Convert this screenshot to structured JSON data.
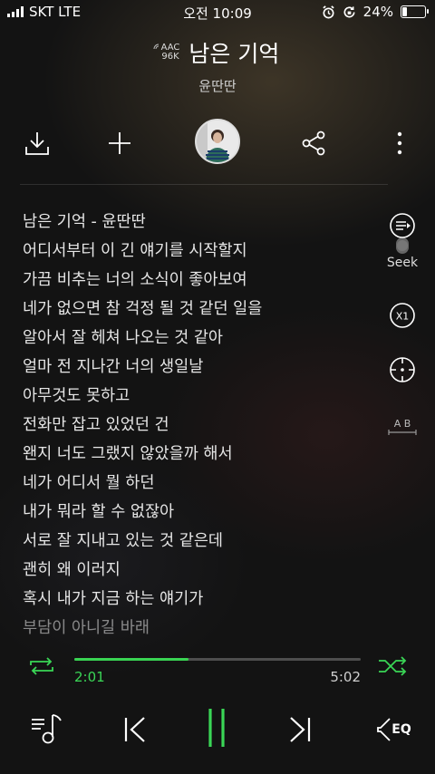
{
  "status_bar": {
    "carrier": "SKT LTE",
    "time": "오전 10:09",
    "battery": "24%",
    "battery_level": 0.24
  },
  "header": {
    "codec_line1": "AAC",
    "codec_line2": "96K",
    "song_title": "남은 기억",
    "artist": "윤딴딴"
  },
  "actions": {
    "icons": [
      "download-icon",
      "add-icon",
      "album-art",
      "share-icon",
      "more-icon"
    ]
  },
  "lyrics": [
    "남은 기억 - 윤딴딴",
    "어디서부터 이 긴 얘기를 시작할지",
    "가끔 비추는 너의 소식이 좋아보여",
    "네가 없으면 참 걱정 될 것 같던 일을",
    "알아서 잘 헤쳐 나오는 것 같아",
    "얼마 전 지나간 너의 생일날",
    "아무것도 못하고",
    "전화만 잡고 있었던 건",
    "왠지 너도 그랬지 않았을까 해서",
    "네가 어디서 뭘 하던",
    "내가 뭐라 할 수 없잖아",
    "서로 잘 지내고 있는 것 같은데",
    "괜히 왜 이러지",
    "혹시 내가 지금 하는 얘기가",
    "부담이 아니길 바래"
  ],
  "side_controls": {
    "seek_label": "Seek",
    "speed_label": "X1",
    "ab_label": "A B"
  },
  "player": {
    "current_time": "2:01",
    "total_time": "5:02",
    "progress_fraction": 0.4,
    "accent_color": "#3ad656",
    "eq_label": "EQ"
  }
}
